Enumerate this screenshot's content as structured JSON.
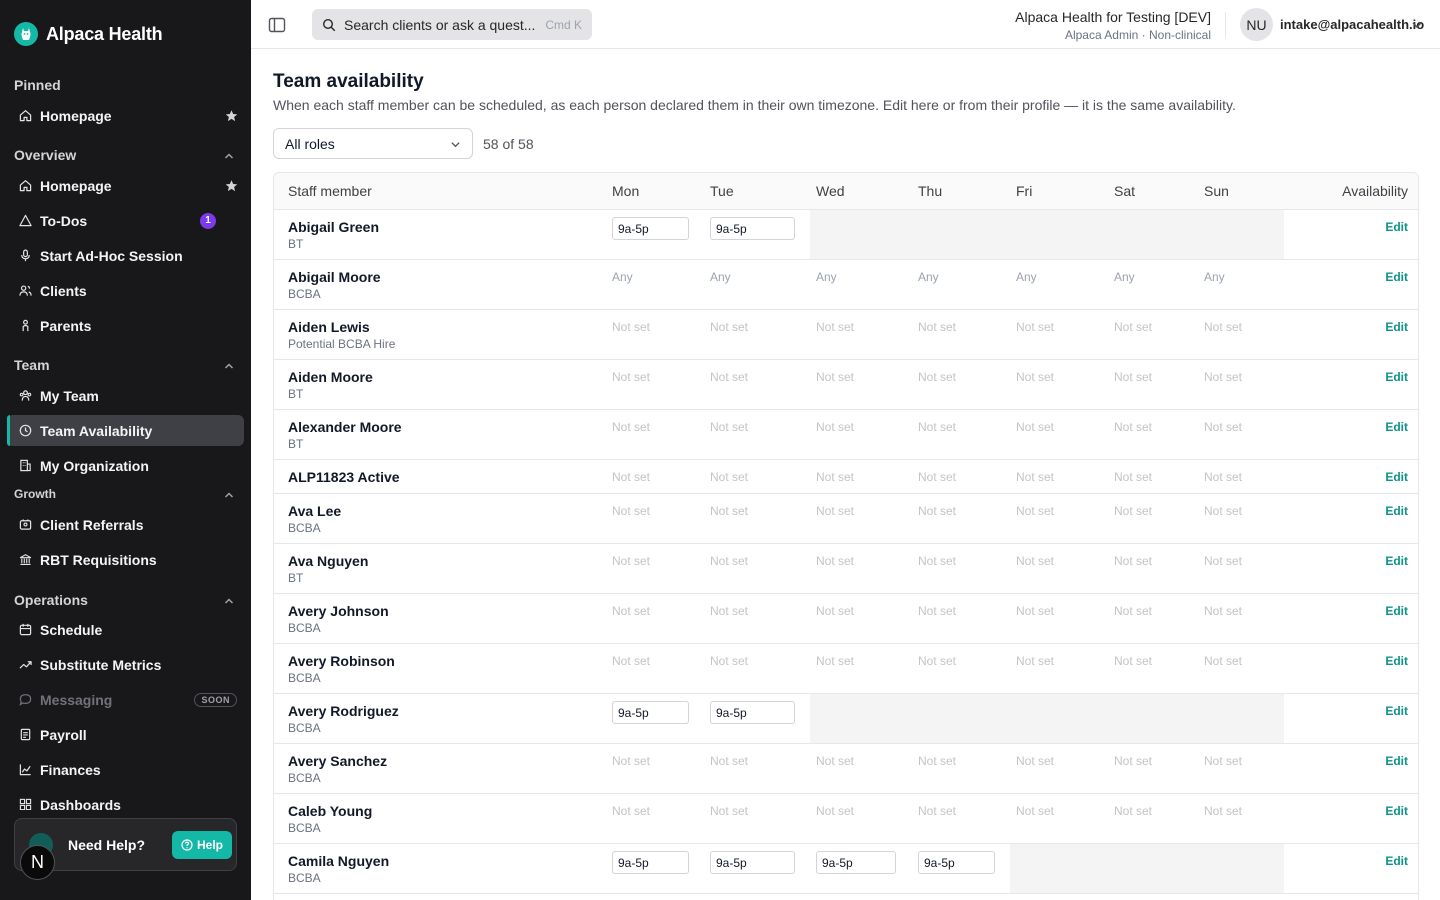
{
  "brand": {
    "name": "Alpaca Health"
  },
  "sidebar": {
    "sections": {
      "pinned": "Pinned",
      "overview": "Overview",
      "team": "Team",
      "growth": "Growth",
      "operations": "Operations"
    },
    "items": {
      "pinned_homepage": "Homepage",
      "homepage": "Homepage",
      "todos": "To-Dos",
      "todos_count": "1",
      "adhoc": "Start Ad-Hoc Session",
      "clients": "Clients",
      "parents": "Parents",
      "my_team": "My Team",
      "team_availability": "Team Availability",
      "my_org": "My Organization",
      "client_referrals": "Client Referrals",
      "rbt_requisitions": "RBT Requisitions",
      "schedule": "Schedule",
      "substitute_metrics": "Substitute Metrics",
      "messaging": "Messaging",
      "messaging_badge": "SOON",
      "payroll": "Payroll",
      "finances": "Finances",
      "dashboards": "Dashboards"
    },
    "help": {
      "title": "Need Help?",
      "button": "Help"
    },
    "avatar_letter": "N"
  },
  "topbar": {
    "search_placeholder": "Search clients or ask a quest...",
    "search_shortcut": "Cmd K",
    "org_name": "Alpaca Health for Testing [DEV]",
    "org_role": "Alpaca Admin · Non-clinical",
    "user_initials": "NU",
    "user_email": "intake@alpacahealth.io"
  },
  "page": {
    "title": "Team availability",
    "description": "When each staff member can be scheduled, as each person declared them in their own timezone. Edit here or from their profile — it is the same availability.",
    "role_filter": "All roles",
    "count": "58 of 58"
  },
  "table": {
    "headers": {
      "staff": "Staff member",
      "mon": "Mon",
      "tue": "Tue",
      "wed": "Wed",
      "thu": "Thu",
      "fri": "Fri",
      "sat": "Sat",
      "sun": "Sun",
      "availability": "Availability"
    },
    "edit_label": "Edit",
    "rows": [
      {
        "name": "Abigail Green",
        "role": "BT",
        "days": [
          "9a-5p",
          "9a-5p",
          "",
          "",
          "",
          "",
          ""
        ]
      },
      {
        "name": "Abigail Moore",
        "role": "BCBA",
        "days": [
          "Any",
          "Any",
          "Any",
          "Any",
          "Any",
          "Any",
          "Any"
        ]
      },
      {
        "name": "Aiden Lewis",
        "role": "Potential BCBA Hire",
        "days": [
          "Not set",
          "Not set",
          "Not set",
          "Not set",
          "Not set",
          "Not set",
          "Not set"
        ]
      },
      {
        "name": "Aiden Moore",
        "role": "BT",
        "days": [
          "Not set",
          "Not set",
          "Not set",
          "Not set",
          "Not set",
          "Not set",
          "Not set"
        ]
      },
      {
        "name": "Alexander Moore",
        "role": "BT",
        "days": [
          "Not set",
          "Not set",
          "Not set",
          "Not set",
          "Not set",
          "Not set",
          "Not set"
        ]
      },
      {
        "name": "ALP11823 Active",
        "role": "",
        "days": [
          "Not set",
          "Not set",
          "Not set",
          "Not set",
          "Not set",
          "Not set",
          "Not set"
        ]
      },
      {
        "name": "Ava Lee",
        "role": "BCBA",
        "days": [
          "Not set",
          "Not set",
          "Not set",
          "Not set",
          "Not set",
          "Not set",
          "Not set"
        ]
      },
      {
        "name": "Ava Nguyen",
        "role": "BT",
        "days": [
          "Not set",
          "Not set",
          "Not set",
          "Not set",
          "Not set",
          "Not set",
          "Not set"
        ]
      },
      {
        "name": "Avery Johnson",
        "role": "BCBA",
        "days": [
          "Not set",
          "Not set",
          "Not set",
          "Not set",
          "Not set",
          "Not set",
          "Not set"
        ]
      },
      {
        "name": "Avery Robinson",
        "role": "BCBA",
        "days": [
          "Not set",
          "Not set",
          "Not set",
          "Not set",
          "Not set",
          "Not set",
          "Not set"
        ]
      },
      {
        "name": "Avery Rodriguez",
        "role": "BCBA",
        "days": [
          "9a-5p",
          "9a-5p",
          "",
          "",
          "",
          "",
          ""
        ]
      },
      {
        "name": "Avery Sanchez",
        "role": "BCBA",
        "days": [
          "Not set",
          "Not set",
          "Not set",
          "Not set",
          "Not set",
          "Not set",
          "Not set"
        ]
      },
      {
        "name": "Caleb Young",
        "role": "BCBA",
        "days": [
          "Not set",
          "Not set",
          "Not set",
          "Not set",
          "Not set",
          "Not set",
          "Not set"
        ]
      },
      {
        "name": "Camila Nguyen",
        "role": "BCBA",
        "days": [
          "9a-5p",
          "9a-5p",
          "9a-5p",
          "9a-5p",
          "",
          "",
          ""
        ]
      }
    ]
  },
  "colors": {
    "accent": "#14b8a6",
    "link": "#0d9488",
    "sidebar_bg": "#18181b",
    "todo_badge": "#7c3aed"
  }
}
